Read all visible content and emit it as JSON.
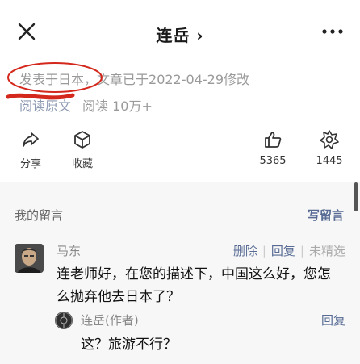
{
  "header": {
    "title": "连岳",
    "chevron": "›",
    "close_icon": "close-icon",
    "more_icon": "more-icon"
  },
  "meta": {
    "published": "发表于日本，",
    "modified": "文章已于2022-04-29修改"
  },
  "read": {
    "original": "阅读原文",
    "count": "阅读 10万+"
  },
  "actions": {
    "share": "分享",
    "favorite": "收藏",
    "likes": "5365",
    "wows": "1445"
  },
  "comments": {
    "header": "我的留言",
    "write": "写留言",
    "items": [
      {
        "author": "马东",
        "delete": "删除",
        "reply": "回复",
        "status": "未精选",
        "body": "连老师好，在您的描述下，中国这么好，您怎么抛弃他去日本了？",
        "replies": [
          {
            "author": "连岳(作者)",
            "reply": "回复",
            "body": "这？旅游不行？"
          }
        ]
      }
    ]
  },
  "colors": {
    "link": "#576b95",
    "muted": "#9a9a9a",
    "annotation": "#d4281c"
  }
}
